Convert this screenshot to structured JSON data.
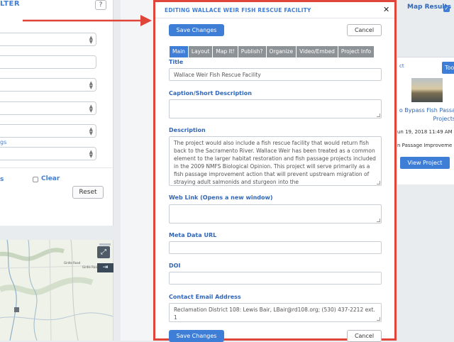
{
  "left_panel": {
    "title": "LTER",
    "help_icon": "?",
    "link_text": "gs",
    "small_label": "s",
    "clear_label": "Clear",
    "reset_label": "Reset"
  },
  "map": {
    "labels": [
      "Girdle Road",
      "Girdle Road"
    ],
    "expand_icon": "⤢",
    "arrow_icon": "⇥"
  },
  "results": {
    "title": "Map Results",
    "check_icon": "✓",
    "card_top_label": "ct",
    "top_button": "Too",
    "project_name": "o Bypass Fish Passa Projects",
    "date": "un 19, 2018 11:49 AM",
    "type": "n Passage Improveme",
    "view_button": "View Project"
  },
  "modal": {
    "title": "EDITING WALLACE WEIR FISH RESCUE FACILITY",
    "close_icon": "✕",
    "save_label": "Save Changes",
    "cancel_label": "Cancel",
    "tabs": [
      "Main",
      "Layout",
      "Map It!",
      "Publish?",
      "Organize",
      "Video/Embed",
      "Project Info"
    ],
    "active_tab": "Main",
    "fields": {
      "title_label": "Title",
      "title_value": "Wallace Weir Fish Rescue Facility",
      "caption_label": "Caption/Short Description",
      "caption_value": "",
      "description_label": "Description",
      "description_value": "The project would also include a fish rescue facility that would return fish back to the Sacramento River. Wallace Weir has been treated as a common element to the larger habitat restoration and fish passage projects included in the 2009 NMFS Biological Opinion. This project will serve primarily as a fish passage improvement action that will prevent upstream migration of straying adult salmonids and sturgeon into the",
      "weblink_label": "Web Link (Opens a new window)",
      "weblink_value": "",
      "metadata_label": "Meta Data URL",
      "metadata_value": "",
      "doi_label": "DOI",
      "doi_value": "",
      "contact_label": "Contact Email Address",
      "contact_value": "Reclamation District 108: Lewis Bair, LBair@rd108.org; (530) 437-2212 ext. 1"
    }
  },
  "colors": {
    "accent": "#3f7ed6",
    "highlight_border": "#e0453a",
    "tab_inactive": "#8d9297"
  }
}
